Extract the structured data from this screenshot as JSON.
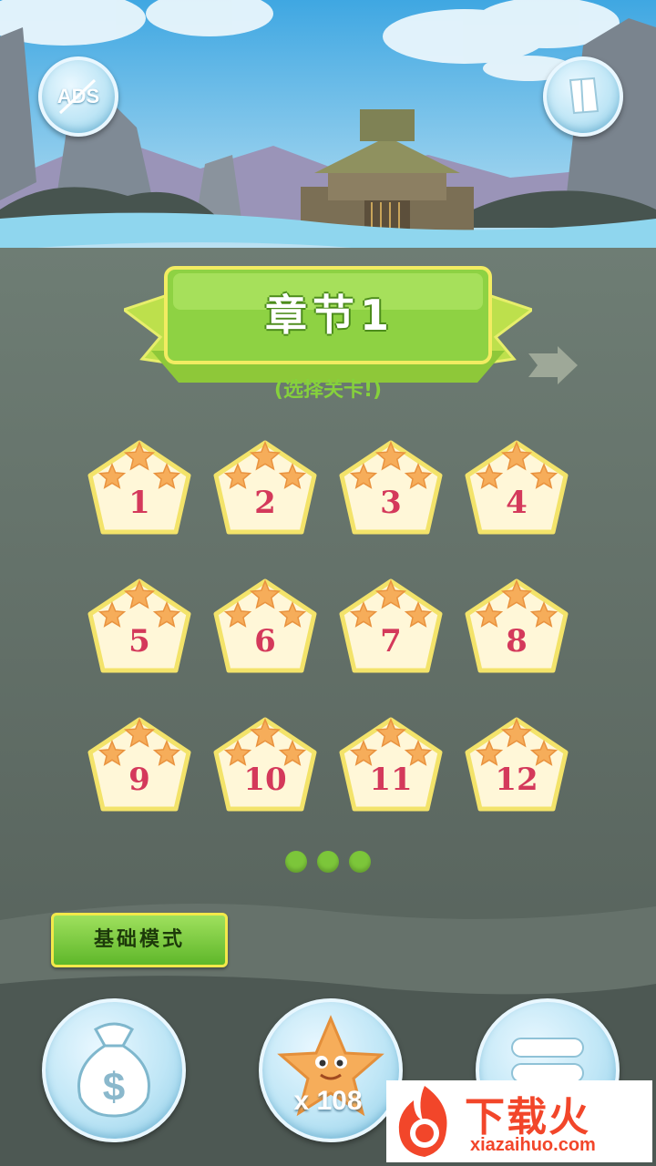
{
  "header": {
    "ads_label": "ADS"
  },
  "chapter": {
    "title": "章节1",
    "subtitle": "(选择关卡!)"
  },
  "levels": [
    {
      "label": "1"
    },
    {
      "label": "2"
    },
    {
      "label": "3"
    },
    {
      "label": "4"
    },
    {
      "label": "5"
    },
    {
      "label": "6"
    },
    {
      "label": "7"
    },
    {
      "label": "8"
    },
    {
      "label": "9"
    },
    {
      "label": "10"
    },
    {
      "label": "11"
    },
    {
      "label": "12"
    }
  ],
  "pagination": {
    "pages": 3
  },
  "mode_button": {
    "label": "基础模式"
  },
  "bottom_bar": {
    "shop_icon": "money-bag-icon",
    "star_count": "x 108",
    "menu_icon": "menu-icon"
  },
  "watermark": {
    "title": "下载火",
    "url": "xiazaihuo.com"
  },
  "colors": {
    "accent_green": "#7cc63a",
    "level_number": "#d4395b",
    "button_blue": "#bfe6f6"
  }
}
